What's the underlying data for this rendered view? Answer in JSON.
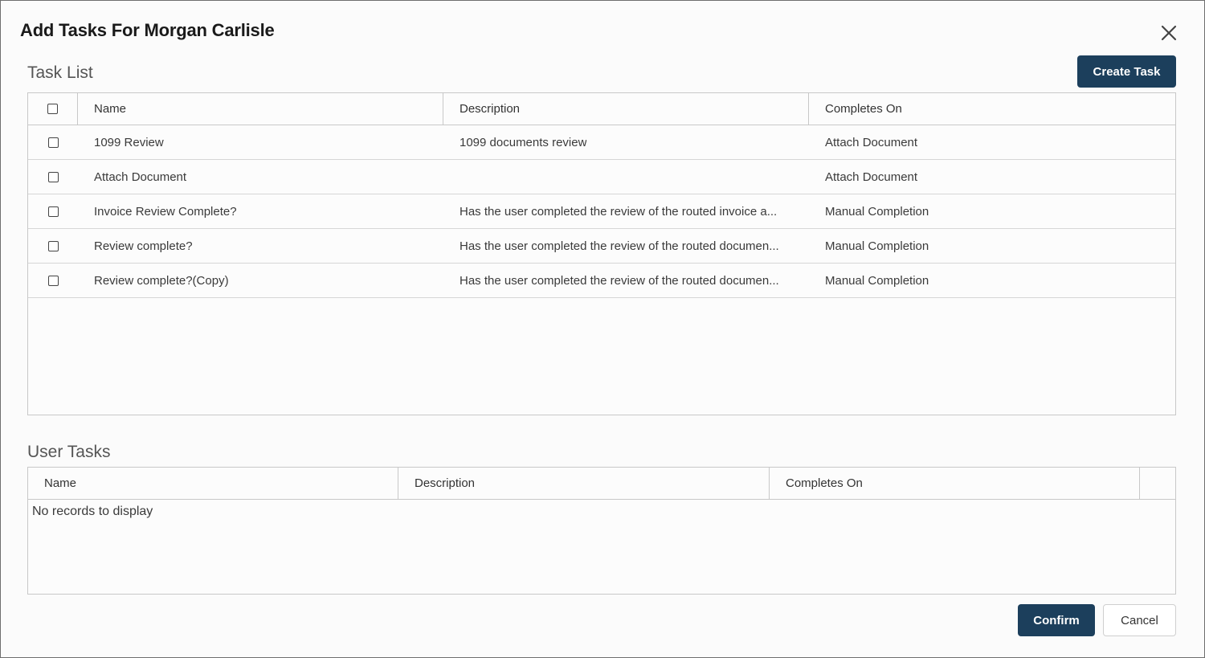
{
  "dialog": {
    "title": "Add Tasks For Morgan Carlisle",
    "close_icon": "close-icon"
  },
  "task_list": {
    "title": "Task List",
    "create_button_label": "Create Task",
    "columns": {
      "name": "Name",
      "description": "Description",
      "completes_on": "Completes On"
    },
    "rows": [
      {
        "name": "1099 Review",
        "description": "1099 documents review",
        "completes_on": "Attach Document"
      },
      {
        "name": "Attach Document",
        "description": "",
        "completes_on": "Attach Document"
      },
      {
        "name": "Invoice Review Complete?",
        "description": "Has the user completed the review of the routed invoice a...",
        "completes_on": "Manual Completion"
      },
      {
        "name": "Review complete?",
        "description": "Has the user completed the review of the routed documen...",
        "completes_on": "Manual Completion"
      },
      {
        "name": "Review complete?(Copy)",
        "description": "Has the user completed the review of the routed documen...",
        "completes_on": "Manual Completion"
      }
    ]
  },
  "user_tasks": {
    "title": "User Tasks",
    "columns": {
      "name": "Name",
      "description": "Description",
      "completes_on": "Completes On"
    },
    "empty_message": "No records to display"
  },
  "footer": {
    "confirm_label": "Confirm",
    "cancel_label": "Cancel"
  },
  "colors": {
    "primary_button": "#1c3f5c",
    "border": "#c8c8c8"
  }
}
